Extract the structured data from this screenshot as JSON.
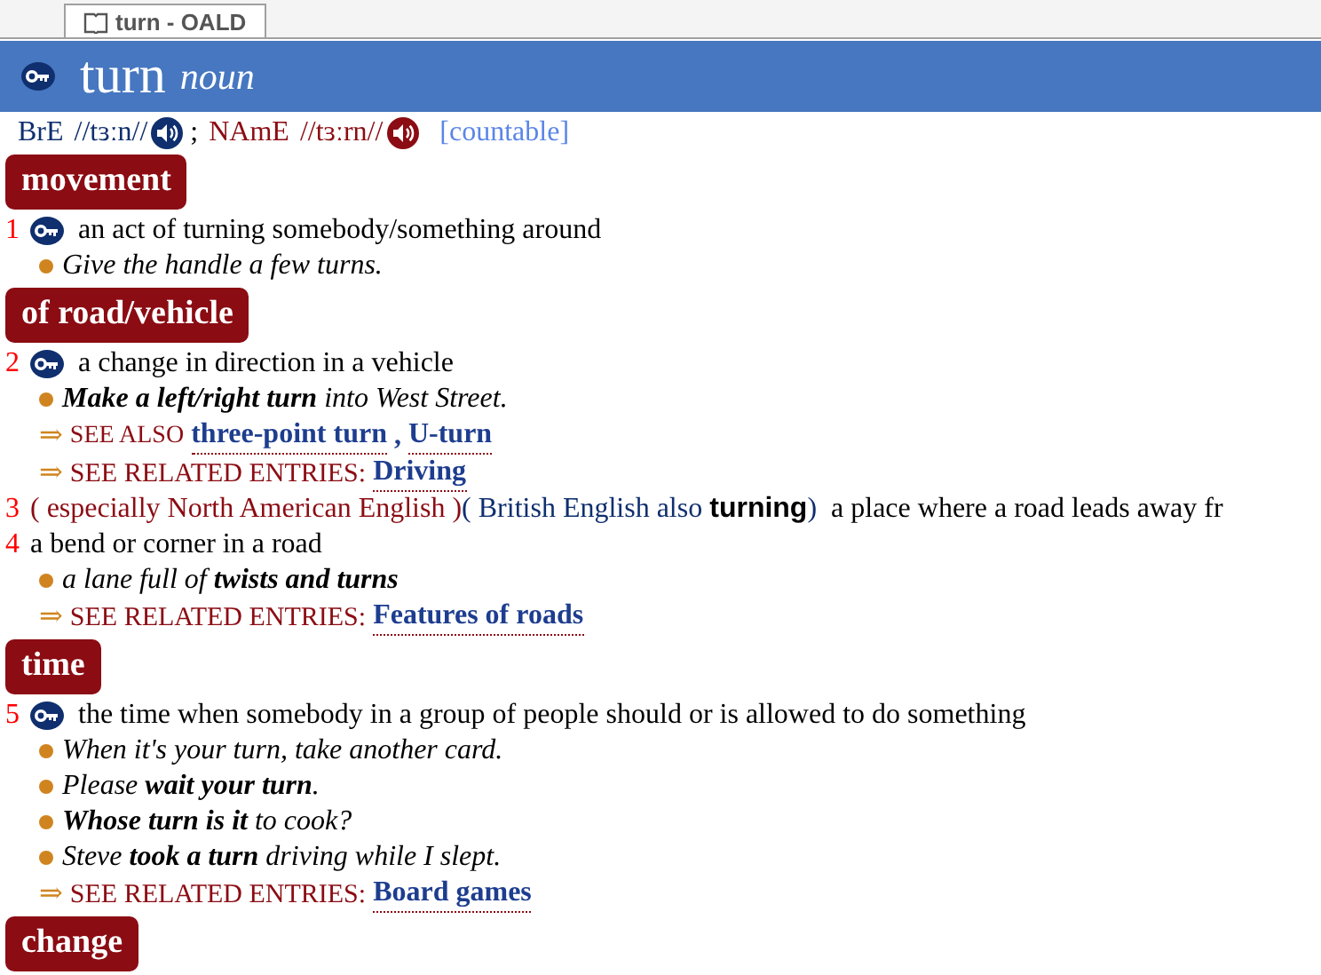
{
  "tab": {
    "label": "turn - OALD",
    "selected": true
  },
  "header": {
    "headword": "turn",
    "pos": "noun"
  },
  "pronunciation": {
    "bre_label": "BrE",
    "bre": "//tɜːn//",
    "separator": ";",
    "name_label": "NAmE",
    "name": "//tɜːrn//",
    "grammar": "[countable]"
  },
  "sections": [
    {
      "title": "movement",
      "senses": [
        {
          "number": "1",
          "key": true,
          "definition": "an act of turning somebody/something around",
          "examples": [
            "Give the handle a few turns."
          ]
        }
      ]
    },
    {
      "title": "of road/vehicle",
      "senses": [
        {
          "number": "2",
          "key": true,
          "definition": "a change in direction in a vehicle",
          "examples": [
            "**Make a left/right turn** into West Street."
          ],
          "xrefs": [
            {
              "kind": "see_also",
              "marker": "⇒",
              "label": "SEE ALSO",
              "links": [
                "three-point turn",
                "U-turn"
              ],
              "joiner": ","
            },
            {
              "kind": "related",
              "marker": "⇒",
              "label": "SEE RELATED ENTRIES:",
              "links": [
                "Driving"
              ]
            }
          ]
        },
        {
          "number": "3",
          "key": false,
          "labels": [
            {
              "kind": "region",
              "text": "( especially North American English )"
            },
            {
              "kind": "variant",
              "text": "( British English also"
            },
            {
              "kind": "word",
              "text": "turning"
            },
            {
              "kind": "variant",
              "text": ")"
            }
          ],
          "definition": "a place where a road leads away fr"
        },
        {
          "number": "4",
          "key": false,
          "definition": "a bend or corner in a road",
          "examples": [
            "a lane full of **twists and turns**"
          ],
          "xrefs": [
            {
              "kind": "related",
              "marker": "⇒",
              "label": "SEE RELATED ENTRIES:",
              "links": [
                "Features of roads"
              ]
            }
          ]
        }
      ]
    },
    {
      "title": "time",
      "senses": [
        {
          "number": "5",
          "key": true,
          "definition": "the time when somebody in a group of people should or is allowed to do something",
          "examples": [
            "When it's your turn, take another card.",
            "Please **wait your turn**.",
            "**Whose turn is it** to cook?",
            "Steve **took a turn** driving while I slept."
          ],
          "xrefs": [
            {
              "kind": "related",
              "marker": "⇒",
              "label": "SEE RELATED ENTRIES:",
              "links": [
                "Board games"
              ]
            }
          ]
        }
      ]
    },
    {
      "title": "change"
    }
  ]
}
